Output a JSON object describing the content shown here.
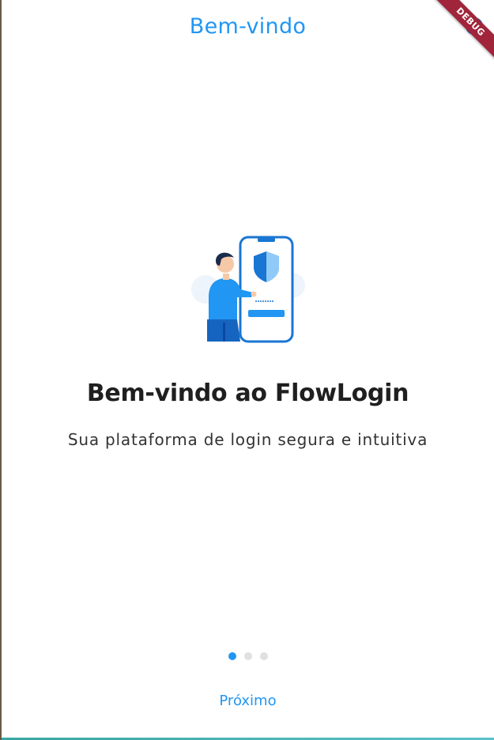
{
  "app_bar": {
    "title": "Bem-vindo"
  },
  "debug_banner": {
    "label": "DEBUG"
  },
  "onboarding": {
    "headline": "Bem-vindo ao FlowLogin",
    "subtitle": "Sua plataforma de login segura e intuitiva",
    "illustration_icon": "person-with-secure-phone-illustration"
  },
  "pager": {
    "total_pages": 3,
    "current_page": 1
  },
  "actions": {
    "next_label": "Próximo"
  },
  "colors": {
    "accent": "#2196f3",
    "text_dark": "#1f1f1f",
    "dot_inactive": "#e0e0e0",
    "debug_red": "#a0253b"
  }
}
